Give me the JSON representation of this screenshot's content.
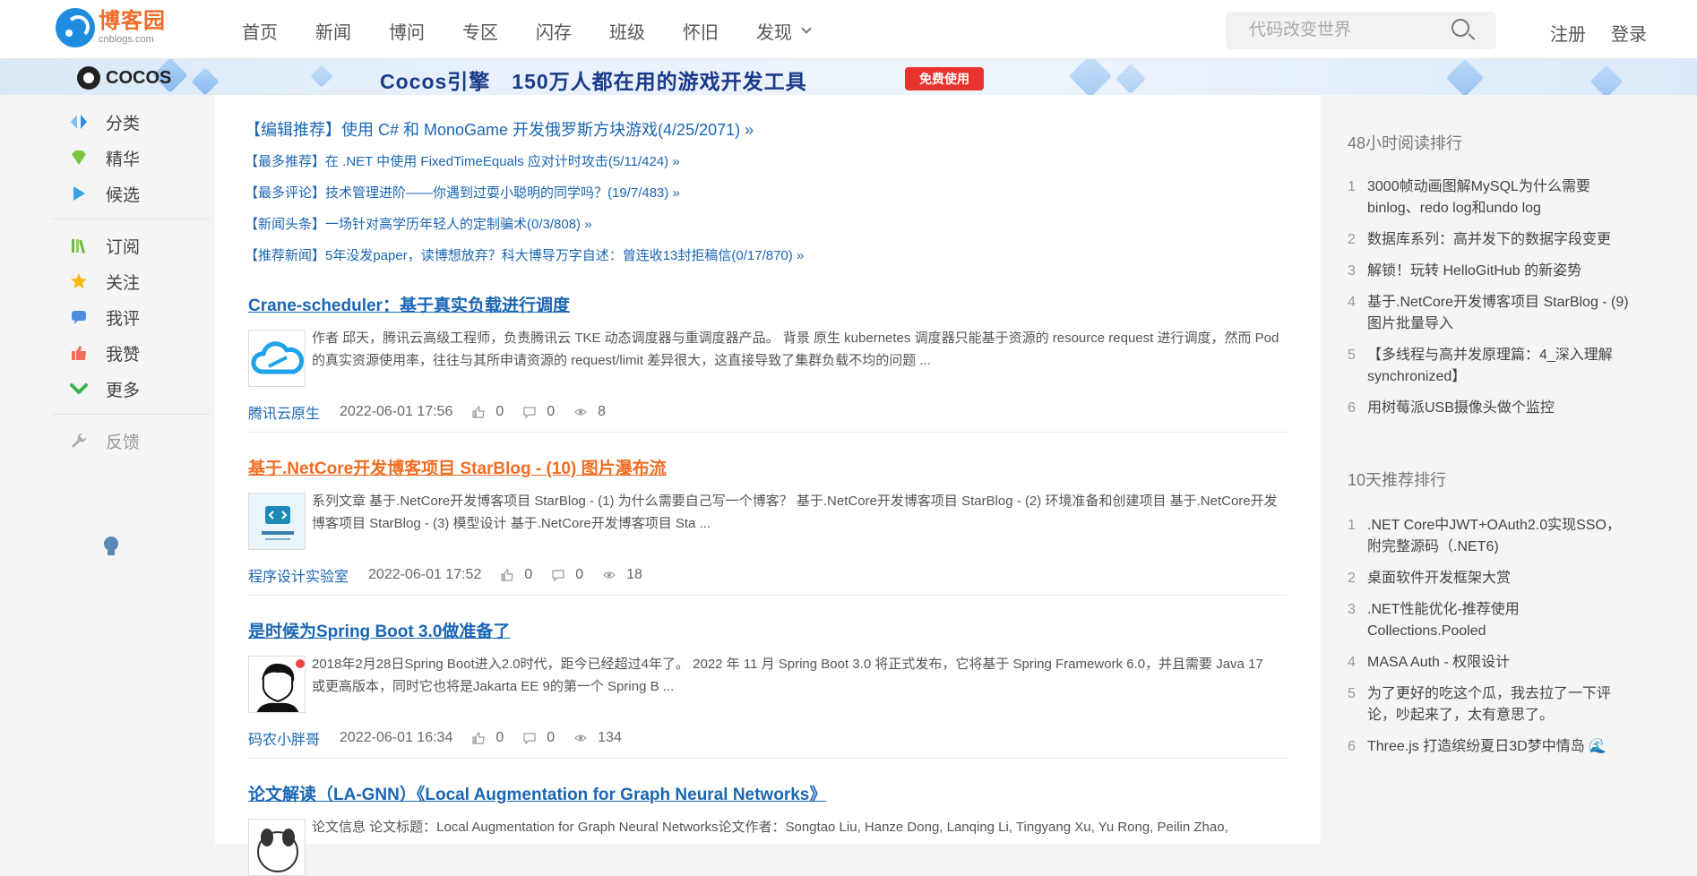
{
  "header": {
    "logo_cn": "博客园",
    "logo_en": "cnblogs.com",
    "nav": [
      "首页",
      "新闻",
      "博问",
      "专区",
      "闪存",
      "班级",
      "怀旧",
      "发现"
    ],
    "search_placeholder": "代码改变世界",
    "register": "注册",
    "login": "登录"
  },
  "banner": {
    "brand": "COCOS",
    "text": "Cocos引擎　150万人都在用的游戏开发工具",
    "button": "免费使用"
  },
  "sidebar": {
    "items": [
      {
        "label": "分类",
        "icon": "category-icon"
      },
      {
        "label": "精华",
        "icon": "gem-icon"
      },
      {
        "label": "候选",
        "icon": "play-icon"
      },
      {
        "label": "订阅",
        "icon": "books-icon"
      },
      {
        "label": "关注",
        "icon": "star-icon"
      },
      {
        "label": "我评",
        "icon": "comment-icon"
      },
      {
        "label": "我赞",
        "icon": "thumbs-up-icon"
      },
      {
        "label": "更多",
        "icon": "chevron-down-icon"
      },
      {
        "label": "反馈",
        "icon": "wrench-icon"
      }
    ],
    "bulb_icon": "lightbulb-icon",
    "colors": {
      "category": "#2e8fe0",
      "gem": "#7ec53e",
      "play": "#3ba0e6",
      "books": "#6cba3f",
      "star": "#f5b90f",
      "comment": "#4a8fe0",
      "thumb": "#f0705a",
      "chevron": "#39b54a"
    }
  },
  "picks": [
    "【编辑推荐】使用 C# 和 MonoGame 开发俄罗斯方块游戏(4/25/2071) »",
    "【最多推荐】在 .NET 中使用 FixedTimeEquals 应对计时攻击(5/11/424) »",
    "【最多评论】技术管理进阶——你遇到过耍小聪明的同学吗？(19/7/483) »",
    "【新闻头条】一场针对高学历年轻人的定制骗术(0/3/808) »",
    "【推荐新闻】5年没发paper，读博想放弃？科大博导万字自述：曾连收13封拒稿信(0/17/870) »"
  ],
  "posts": [
    {
      "title": "Crane-scheduler：基于真实负载进行调度",
      "title_color": "#1a66b3",
      "summary": "作者 邱天，腾讯云高级工程师，负责腾讯云 TKE 动态调度器与重调度器产品。 背景 原生 kubernetes 调度器只能基于资源的 resource request 进行调度，然而 Pod 的真实资源使用率，往往与其所申请资源的 request/limit 差异很大，这直接导致了集群负载不均的问题 ...",
      "author": "腾讯云原生",
      "date": "2022-06-01 17:56",
      "likes": "0",
      "comments": "0",
      "views": "8"
    },
    {
      "title": "基于.NetCore开发博客项目 StarBlog - (10) 图片瀑布流",
      "title_color": "#f26d21",
      "summary": "系列文章 基于.NetCore开发博客项目 StarBlog - (1) 为什么需要自己写一个博客？ 基于.NetCore开发博客项目 StarBlog - (2) 环境准备和创建项目 基于.NetCore开发博客项目 StarBlog - (3) 模型设计 基于.NetCore开发博客项目 Sta ...",
      "author": "程序设计实验室",
      "date": "2022-06-01 17:52",
      "likes": "0",
      "comments": "0",
      "views": "18"
    },
    {
      "title": "是时候为Spring Boot 3.0做准备了",
      "title_color": "#1a66b3",
      "summary": "2018年2月28日Spring Boot进入2.0时代，距今已经超过4年了。 2022 年 11 月 Spring Boot 3.0 将正式发布，它将基于 Spring Framework 6.0，并且需要 Java 17 或更高版本，同时它也将是Jakarta EE 9的第一个 Spring B ...",
      "author": "码农小胖哥",
      "date": "2022-06-01 16:34",
      "likes": "0",
      "comments": "0",
      "views": "134"
    },
    {
      "title": "论文解读（LA-GNN）《Local Augmentation for Graph Neural Networks》",
      "title_color": "#1a66b3",
      "summary": "论文信息 论文标题：Local Augmentation for Graph Neural Networks论文作者：Songtao Liu, Hanze Dong, Lanqing Li, Tingyang Xu, Yu Rong, Peilin Zhao,",
      "author": "",
      "date": "",
      "likes": "",
      "comments": "",
      "views": ""
    }
  ],
  "right": {
    "rank48_title": "48小时阅读排行",
    "rank48": [
      "3000帧动画图解MySQL为什么需要binlog、redo log和undo log",
      "数据库系列：高并发下的数据字段变更",
      "解锁！玩转 HelloGitHub 的新姿势",
      "基于.NetCore开发博客项目 StarBlog - (9) 图片批量导入",
      "【多线程与高并发原理篇：4_深入理解synchronized】",
      "用树莓派USB摄像头做个监控"
    ],
    "rank10_title": "10天推荐排行",
    "rank10": [
      ".NET Core中JWT+OAuth2.0实现SSO，附完整源码（.NET6)",
      "桌面软件开发框架大赏",
      ".NET性能优化-推荐使用Collections.Pooled",
      "MASA Auth - 权限设计",
      "为了更好的吃这个瓜，我去拉了一下评论，吵起来了，太有意思了。",
      "Three.js 打造缤纷夏日3D梦中情岛 🌊"
    ]
  }
}
